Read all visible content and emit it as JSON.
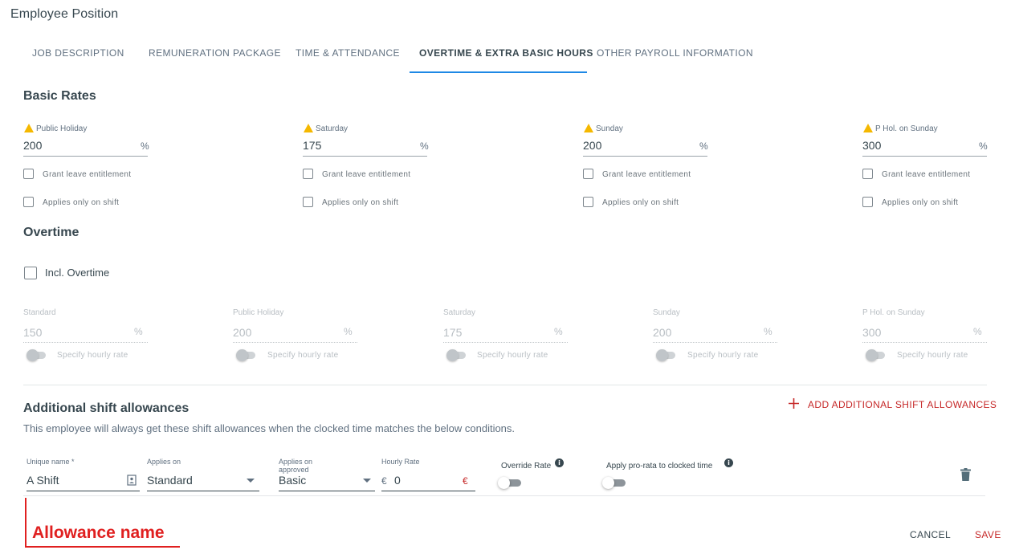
{
  "header": {
    "title": "Employee Position"
  },
  "tabs": [
    {
      "label": "JOB DESCRIPTION"
    },
    {
      "label": "REMUNERATION PACKAGE"
    },
    {
      "label": "TIME & ATTENDANCE"
    },
    {
      "label": "OVERTIME & EXTRA BASIC HOURS"
    },
    {
      "label": "OTHER PAYROLL INFORMATION"
    }
  ],
  "basic_rates": {
    "title": "Basic Rates",
    "unit": "%",
    "grant_leave_label": "Grant leave entitlement",
    "applies_shift_label": "Applies only on shift",
    "fields": [
      {
        "label": "Public Holiday",
        "value": "200"
      },
      {
        "label": "Saturday",
        "value": "175"
      },
      {
        "label": "Sunday",
        "value": "200"
      },
      {
        "label": "P Hol. on Sunday",
        "value": "300"
      }
    ]
  },
  "overtime": {
    "title": "Overtime",
    "incl_label": "Incl. Overtime",
    "unit": "%",
    "specify_label": "Specify hourly rate",
    "fields": [
      {
        "label": "Standard",
        "value": "150"
      },
      {
        "label": "Public Holiday",
        "value": "200"
      },
      {
        "label": "Saturday",
        "value": "175"
      },
      {
        "label": "Sunday",
        "value": "200"
      },
      {
        "label": "P Hol. on Sunday",
        "value": "300"
      }
    ]
  },
  "shift_allowances": {
    "title": "Additional shift allowances",
    "description": "This employee will always get these shift allowances when the clocked time matches the below conditions.",
    "add_label": "ADD ADDITIONAL SHIFT ALLOWANCES",
    "row": {
      "unique_name_label": "Unique name *",
      "unique_name_value": "A Shift",
      "applies_on_label": "Applies on",
      "applies_on_value": "Standard",
      "applies_approved_label_1": "Applies on",
      "applies_approved_label_2": "approved",
      "applies_approved_value": "Basic",
      "hourly_rate_label": "Hourly Rate",
      "currency": "€",
      "hourly_rate_value": "0",
      "override_rate_label": "Override Rate",
      "pro_rata_label": "Apply pro-rata to clocked time",
      "info_glyph": "i"
    }
  },
  "annotation": {
    "text": "Allowance name",
    "color": "#e02020"
  },
  "footer": {
    "cancel_label": "CANCEL",
    "save_label": "SAVE"
  },
  "colors": {
    "accent": "#1e88e5",
    "danger": "#c62828",
    "warning": "#f5b800"
  },
  "icons": {
    "warning": "warning-icon",
    "plus": "plus-icon",
    "trash": "trash-icon",
    "dropdown": "caret-down-icon",
    "contact": "contact-card-icon",
    "info": "info-icon"
  }
}
